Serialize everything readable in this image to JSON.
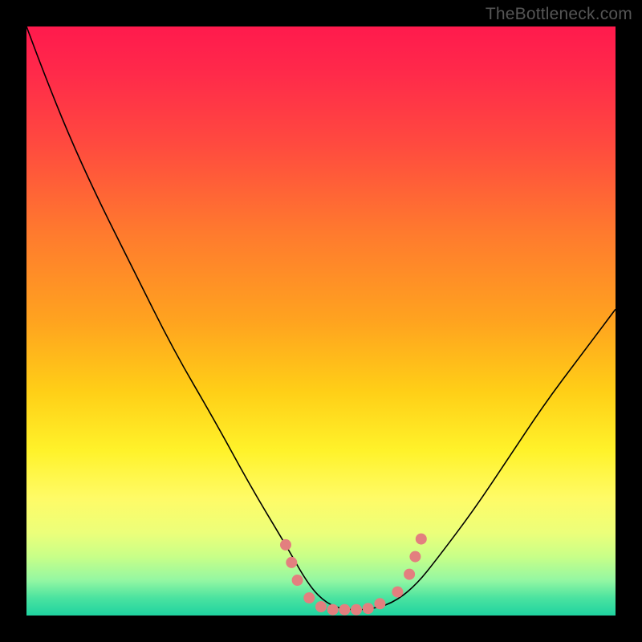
{
  "watermark": "TheBottleneck.com",
  "chart_data": {
    "type": "line",
    "title": "",
    "xlabel": "",
    "ylabel": "",
    "xlim": [
      0,
      100
    ],
    "ylim": [
      0,
      100
    ],
    "grid": false,
    "series": [
      {
        "name": "bottleneck-curve",
        "x": [
          0,
          3,
          7,
          12,
          18,
          25,
          32,
          38,
          44,
          48,
          51,
          54,
          58,
          62,
          66,
          70,
          76,
          82,
          88,
          94,
          100
        ],
        "values": [
          100,
          92,
          82,
          71,
          59,
          45,
          33,
          22,
          12,
          5,
          2,
          1,
          1,
          2,
          5,
          10,
          18,
          27,
          36,
          44,
          52
        ]
      }
    ],
    "markers": {
      "name": "highlight-dots",
      "color": "#e37f7f",
      "points": [
        {
          "x": 44,
          "y": 12
        },
        {
          "x": 45,
          "y": 9
        },
        {
          "x": 46,
          "y": 6
        },
        {
          "x": 48,
          "y": 3
        },
        {
          "x": 50,
          "y": 1.5
        },
        {
          "x": 52,
          "y": 1
        },
        {
          "x": 54,
          "y": 1
        },
        {
          "x": 56,
          "y": 1
        },
        {
          "x": 58,
          "y": 1.2
        },
        {
          "x": 60,
          "y": 2
        },
        {
          "x": 63,
          "y": 4
        },
        {
          "x": 65,
          "y": 7
        },
        {
          "x": 66,
          "y": 10
        },
        {
          "x": 67,
          "y": 13
        }
      ]
    }
  }
}
